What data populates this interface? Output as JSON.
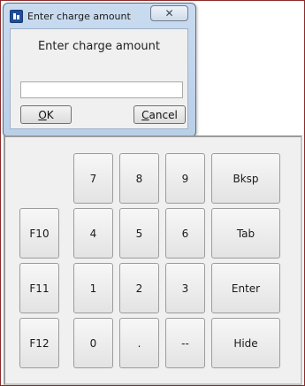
{
  "dialog": {
    "title": "Enter charge amount",
    "close_glyph": "✕",
    "prompt": "Enter charge amount",
    "amount_value": "",
    "ok_mnemonic": "O",
    "ok_rest": "K",
    "cancel_mnemonic": "C",
    "cancel_rest": "ancel"
  },
  "keypad": {
    "f10": "F10",
    "f11": "F11",
    "f12": "F12",
    "k7": "7",
    "k8": "8",
    "k9": "9",
    "k4": "4",
    "k5": "5",
    "k6": "6",
    "k1": "1",
    "k2": "2",
    "k3": "3",
    "k0": "0",
    "dot": ".",
    "dash": "--",
    "bksp": "Bksp",
    "tab": "Tab",
    "enter": "Enter",
    "hide": "Hide"
  },
  "colors": {
    "frame_border": "#8b2b2b",
    "dialog_chrome": "#c9dbef",
    "panel_bg": "#f0f0f0"
  }
}
